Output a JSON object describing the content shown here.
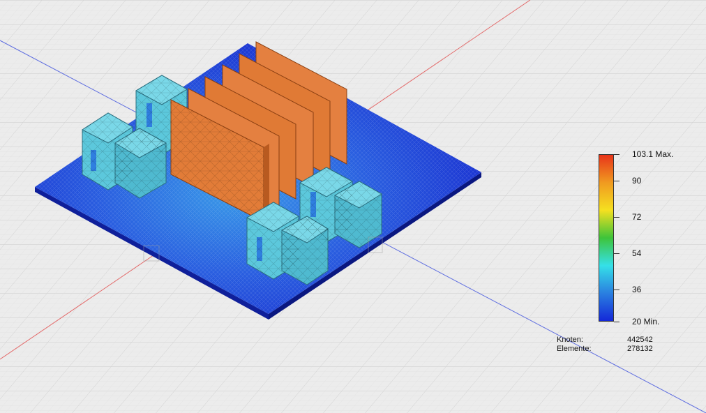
{
  "legend": {
    "ticks": [
      {
        "label": "103.1 Max.",
        "value": 103.1
      },
      {
        "label": "90",
        "value": 90
      },
      {
        "label": "72",
        "value": 72
      },
      {
        "label": "54",
        "value": 54
      },
      {
        "label": "36",
        "value": 36
      },
      {
        "label": "20 Min.",
        "value": 20
      }
    ],
    "gradient_colors": [
      "#e8341a",
      "#f09a20",
      "#f5e020",
      "#3ec43a",
      "#35e0e8",
      "#2a7fe0",
      "#1428d8"
    ]
  },
  "stats": {
    "nodes_label": "Knoten:",
    "nodes_value": "442542",
    "elements_label": "Elemente:",
    "elements_value": "278132"
  },
  "colors": {
    "background": "#ececec",
    "board": "#1f3fd0",
    "hot_fins": "#e07a35",
    "components": "#5cc8dc"
  }
}
